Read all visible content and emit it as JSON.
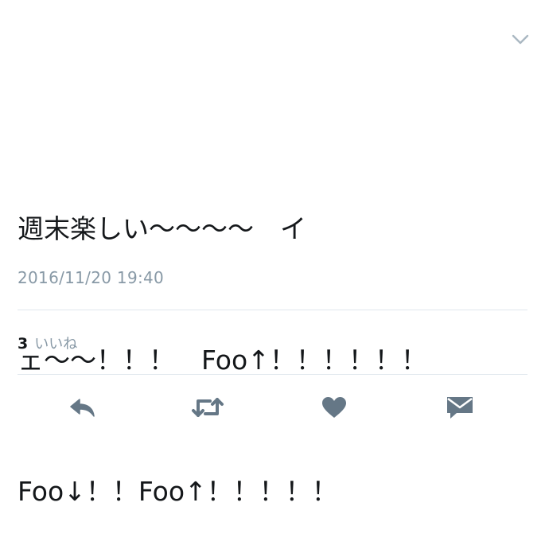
{
  "tweet": {
    "text_lines": [
      "週末楽しい〜〜〜〜　イ",
      "ェ〜〜！！！　Foo↑！！！！！！",
      "Foo↓！！Foo↑！！！！！"
    ],
    "timestamp": "2016/11/20 19:40"
  },
  "stats": {
    "likes_count": "3",
    "likes_label": "いいね"
  },
  "icons": {
    "menu": "chevron-down-icon",
    "reply": "reply-icon",
    "retweet": "retweet-icon",
    "like": "heart-icon",
    "dm": "direct-message-icon"
  },
  "colors": {
    "icon": "#657786",
    "muted_text": "#8899a6",
    "divider": "#e1e8ed",
    "chevron": "#aab8c2"
  }
}
